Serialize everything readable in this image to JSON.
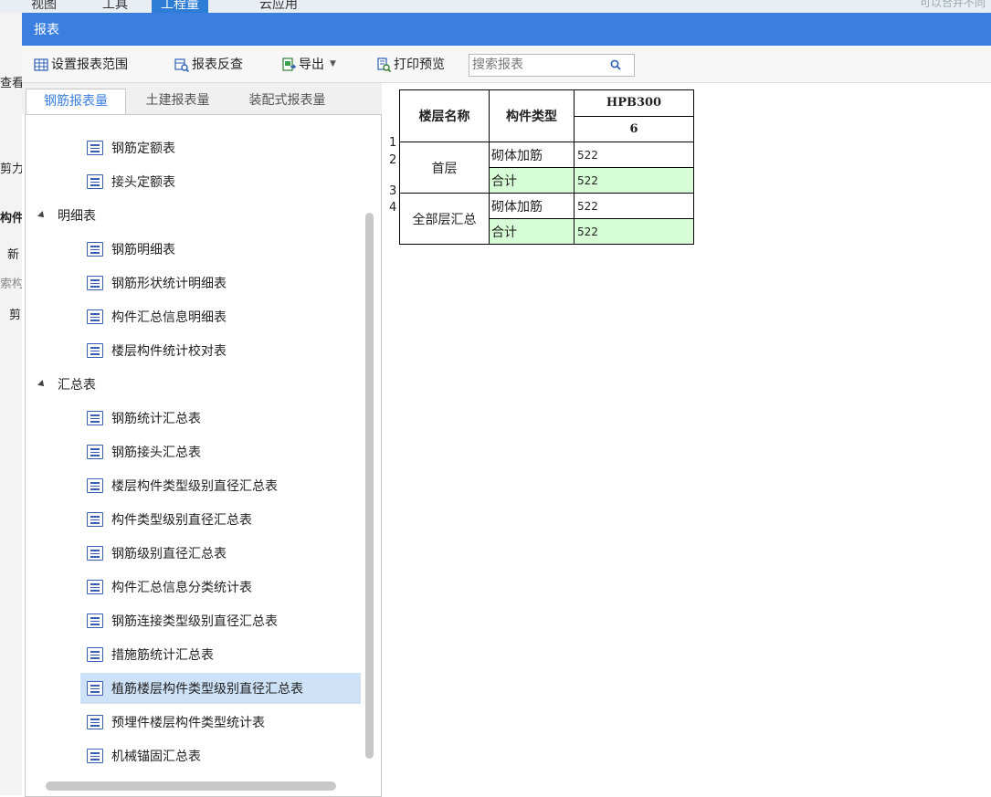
{
  "menubar": {
    "items": [
      {
        "label": "视图"
      },
      {
        "label": "工具"
      },
      {
        "label": "工程量"
      },
      {
        "label": "云应用"
      }
    ],
    "hint": "可以合并不同"
  },
  "left_strip": [
    "查看",
    "剪力",
    "构件",
    "新",
    "索构",
    "剪"
  ],
  "dialog": {
    "title": "报表",
    "toolbar": {
      "set_range": "设置报表范围",
      "reverse_check": "报表反查",
      "export": "导出",
      "print_preview": "打印预览",
      "search_placeholder": "搜索报表"
    },
    "tabs": [
      "钢筋报表量",
      "土建报表量",
      "装配式报表量"
    ],
    "tree": {
      "top_items": [
        "钢筋定额表",
        "接头定额表"
      ],
      "groups": [
        {
          "label": "明细表",
          "items": [
            "钢筋明细表",
            "钢筋形状统计明细表",
            "构件汇总信息明细表",
            "楼层构件统计校对表"
          ]
        },
        {
          "label": "汇总表",
          "items": [
            "钢筋统计汇总表",
            "钢筋接头汇总表",
            "楼层构件类型级别直径汇总表",
            "构件类型级别直径汇总表",
            "钢筋级别直径汇总表",
            "构件汇总信息分类统计表",
            "钢筋连接类型级别直径汇总表",
            "措施筋统计汇总表",
            "植筋楼层构件类型级别直径汇总表",
            "预埋件楼层构件类型统计表",
            "机械锚固汇总表"
          ]
        }
      ],
      "selected": "植筋楼层构件类型级别直径汇总表"
    },
    "report": {
      "headers": {
        "floor": "楼层名称",
        "component": "构件类型",
        "grade": "HPB300",
        "diameter": "6"
      },
      "row_numbers": [
        "1",
        "2",
        "3",
        "4"
      ],
      "groups": [
        {
          "floor": "首层",
          "rows": [
            {
              "type": "砌体加筋",
              "value": "522"
            },
            {
              "type": "合计",
              "value": "522"
            }
          ]
        },
        {
          "floor": "全部层汇总",
          "rows": [
            {
              "type": "砌体加筋",
              "value": "522"
            },
            {
              "type": "合计",
              "value": "522"
            }
          ]
        }
      ]
    }
  },
  "colors": {
    "title_bar": "#3a7ee0",
    "selected_row": "#cde1f7",
    "total_row_fill": "#d6fdd6",
    "tree_icon": "#3b5fb0"
  }
}
